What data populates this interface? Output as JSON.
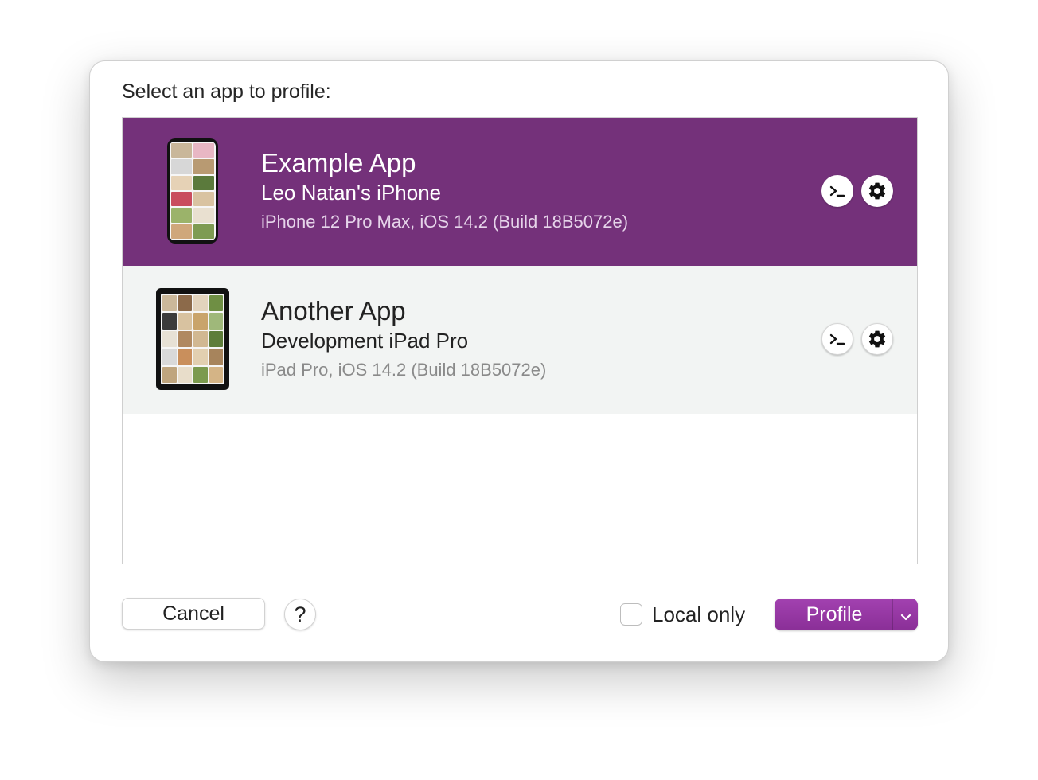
{
  "dialog": {
    "prompt": "Select an app to profile:"
  },
  "apps": [
    {
      "title": "Example App",
      "device": "Leo Natan's iPhone",
      "details": "iPhone 12 Pro Max, iOS 14.2 (Build 18B5072e)",
      "device_type": "iphone",
      "selected": true
    },
    {
      "title": "Another App",
      "device": "Development iPad Pro",
      "details": "iPad Pro, iOS 14.2 (Build 18B5072e)",
      "device_type": "ipad",
      "selected": false
    }
  ],
  "row_icons": [
    "terminal-icon",
    "gear-icon"
  ],
  "footer": {
    "cancel_label": "Cancel",
    "help_label": "?",
    "local_only_label": "Local only",
    "local_only_checked": false,
    "profile_label": "Profile"
  },
  "colors": {
    "selection": "#74317a",
    "accent_button": "#9437a3",
    "alt_row": "#f2f4f3"
  }
}
